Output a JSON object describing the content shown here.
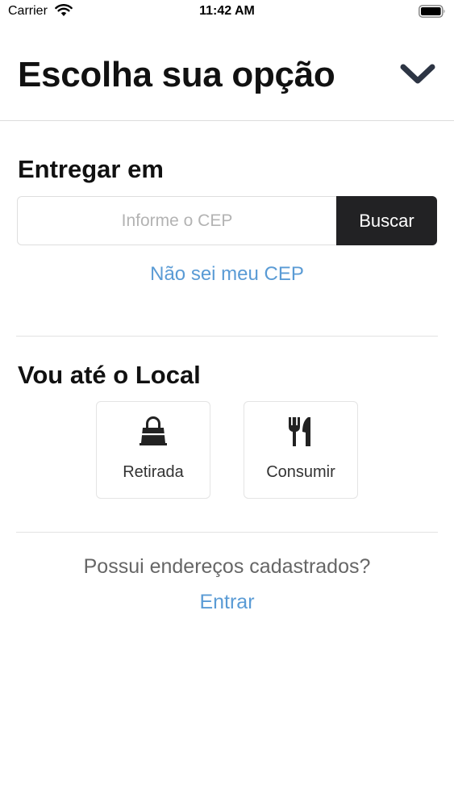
{
  "status_bar": {
    "carrier": "Carrier",
    "time": "11:42 AM",
    "wifi_icon": "wifi-icon",
    "battery_icon": "battery-icon"
  },
  "header": {
    "title": "Escolha sua opção",
    "collapse_icon": "chevron-down-icon"
  },
  "delivery": {
    "title": "Entregar em",
    "cep_placeholder": "Informe o CEP",
    "cep_value": "",
    "search_label": "Buscar",
    "unknown_cep_link": "Não sei meu CEP"
  },
  "local": {
    "title": "Vou até o Local",
    "options": [
      {
        "label": "Retirada",
        "icon": "shopping-bag-icon"
      },
      {
        "label": "Consumir",
        "icon": "fork-knife-icon"
      }
    ]
  },
  "account": {
    "question": "Possui endereços cadastrados?",
    "login_link": "Entrar"
  },
  "colors": {
    "link": "#5a9bd5",
    "button_dark": "#222224",
    "divider": "#e2e2e2"
  }
}
